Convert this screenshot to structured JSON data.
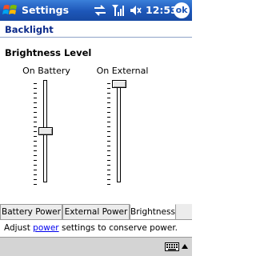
{
  "titlebar": {
    "title": "Settings",
    "time": "12:53",
    "ok_label": "ok",
    "bg": "#1d56b8"
  },
  "header": {
    "title": "Backlight"
  },
  "content": {
    "section_title": "Brightness Level",
    "battery": {
      "label": "On Battery",
      "level": 0.5
    },
    "external": {
      "label": "On External",
      "level": 1.0
    }
  },
  "tabs": [
    {
      "label": "Battery Power",
      "active": false
    },
    {
      "label": "External Power",
      "active": false
    },
    {
      "label": "Brightness",
      "active": true
    }
  ],
  "hint": {
    "prefix": "Adjust ",
    "link": "power",
    "suffix": " settings to conserve power."
  },
  "icons": [
    "windows-logo-icon",
    "sync-icon",
    "signal-icon",
    "volume-icon",
    "keyboard-icon",
    "up-arrow-icon"
  ]
}
